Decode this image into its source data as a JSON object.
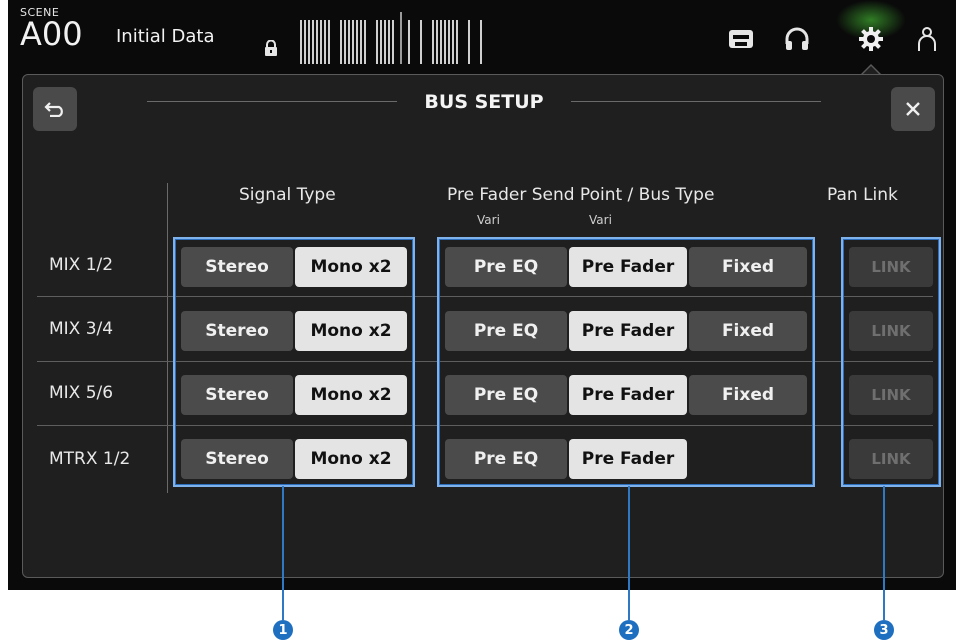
{
  "scene": {
    "label": "SCENE",
    "number": "A00",
    "name": "Initial Data"
  },
  "icons": {
    "lock": "lock-icon",
    "recorder": "recorder-icon",
    "headphones": "headphones-icon",
    "settings": "gear-icon",
    "user": "user-icon",
    "back": "back-arrow-icon",
    "close": "close-icon"
  },
  "panel": {
    "title": "BUS SETUP"
  },
  "columns": {
    "signal_type": "Signal Type",
    "send_point": "Pre Fader Send Point / Bus Type",
    "vari_1": "Vari",
    "vari_2": "Vari",
    "pan_link": "Pan Link"
  },
  "rows": [
    {
      "label": "MIX 1/2",
      "stereo": "Stereo",
      "mono": "Mono x2",
      "pre_eq": "Pre EQ",
      "pre_fader": "Pre Fader",
      "fixed": "Fixed",
      "link": "LINK"
    },
    {
      "label": "MIX 3/4",
      "stereo": "Stereo",
      "mono": "Mono x2",
      "pre_eq": "Pre EQ",
      "pre_fader": "Pre Fader",
      "fixed": "Fixed",
      "link": "LINK"
    },
    {
      "label": "MIX 5/6",
      "stereo": "Stereo",
      "mono": "Mono x2",
      "pre_eq": "Pre EQ",
      "pre_fader": "Pre Fader",
      "fixed": "Fixed",
      "link": "LINK"
    },
    {
      "label": "MTRX 1/2",
      "stereo": "Stereo",
      "mono": "Mono x2",
      "pre_eq": "Pre EQ",
      "pre_fader": "Pre Fader",
      "link": "LINK"
    }
  ],
  "callouts": [
    "1",
    "2",
    "3"
  ],
  "colors": {
    "accent_highlight": "#7fb2ea",
    "callout": "#1f6fc0",
    "settings_glow": "#50dc3c"
  }
}
